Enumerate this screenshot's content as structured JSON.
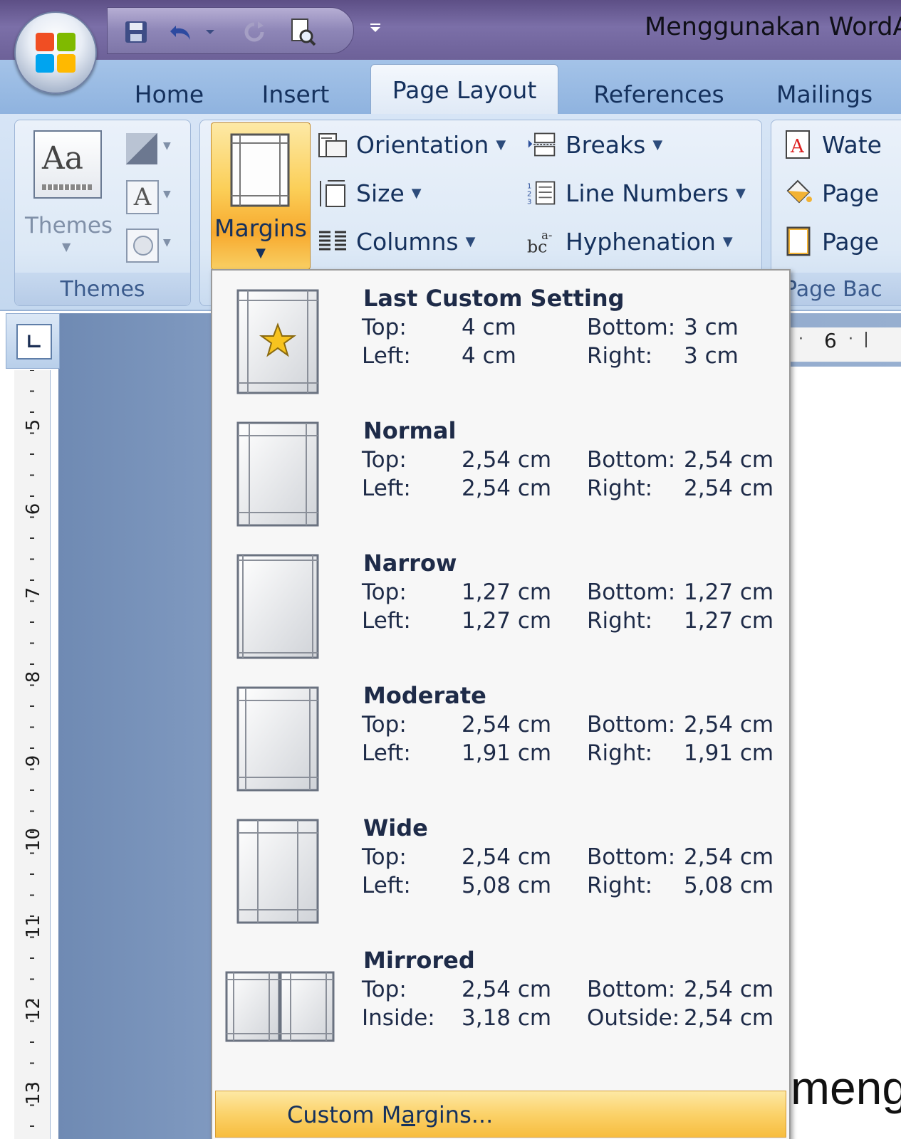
{
  "window": {
    "title": "Menggunakan WordA"
  },
  "tabs": [
    {
      "label": "Home"
    },
    {
      "label": "Insert"
    },
    {
      "label": "Page Layout",
      "active": true
    },
    {
      "label": "References"
    },
    {
      "label": "Mailings"
    }
  ],
  "ribbon": {
    "themes_group": {
      "button": "Themes",
      "label": "Themes"
    },
    "page_setup": {
      "margins": "Margins",
      "orientation": "Orientation",
      "size": "Size",
      "columns": "Columns",
      "breaks": "Breaks",
      "line_numbers": "Line Numbers",
      "hyphenation": "Hyphenation"
    },
    "page_background": {
      "watermark": "Wate",
      "page_color": "Page",
      "page_borders": "Page",
      "label": "Page Bac"
    }
  },
  "ruler": {
    "vertical_numbers": [
      "5",
      "6",
      "7",
      "8",
      "9",
      "10",
      "11",
      "12",
      "13"
    ],
    "horizontal_number": "6"
  },
  "document": {
    "visible_text": "meng"
  },
  "margins_menu": {
    "presets": [
      {
        "name": "Last Custom Setting",
        "top_label": "Top:",
        "top": "4 cm",
        "bottom_label": "Bottom:",
        "bottom": "3 cm",
        "left_label": "Left:",
        "left": "4 cm",
        "right_label": "Right:",
        "right": "3 cm",
        "icon": "star-page-icon"
      },
      {
        "name": "Normal",
        "top_label": "Top:",
        "top": "2,54 cm",
        "bottom_label": "Bottom:",
        "bottom": "2,54 cm",
        "left_label": "Left:",
        "left": "2,54 cm",
        "right_label": "Right:",
        "right": "2,54 cm",
        "icon": "normal-page-icon"
      },
      {
        "name": "Narrow",
        "top_label": "Top:",
        "top": "1,27 cm",
        "bottom_label": "Bottom:",
        "bottom": "1,27 cm",
        "left_label": "Left:",
        "left": "1,27 cm",
        "right_label": "Right:",
        "right": "1,27 cm",
        "icon": "narrow-page-icon"
      },
      {
        "name": "Moderate",
        "top_label": "Top:",
        "top": "2,54 cm",
        "bottom_label": "Bottom:",
        "bottom": "2,54 cm",
        "left_label": "Left:",
        "left": "1,91 cm",
        "right_label": "Right:",
        "right": "1,91 cm",
        "icon": "moderate-page-icon"
      },
      {
        "name": "Wide",
        "top_label": "Top:",
        "top": "2,54 cm",
        "bottom_label": "Bottom:",
        "bottom": "2,54 cm",
        "left_label": "Left:",
        "left": "5,08 cm",
        "right_label": "Right:",
        "right": "5,08 cm",
        "icon": "wide-page-icon"
      },
      {
        "name": "Mirrored",
        "top_label": "Top:",
        "top": "2,54 cm",
        "bottom_label": "Bottom:",
        "bottom": "2,54 cm",
        "left_label": "Inside:",
        "left": "3,18 cm",
        "right_label": "Outside:",
        "right": "2,54 cm",
        "icon": "mirrored-page-icon"
      }
    ],
    "custom_margins": {
      "before": "Custom M",
      "underlined": "a",
      "after": "rgins..."
    }
  },
  "colors": {
    "accent_orange": "#f7a92e",
    "ribbon_blue": "#c4d8ef",
    "title_purple": "#6d6198"
  }
}
